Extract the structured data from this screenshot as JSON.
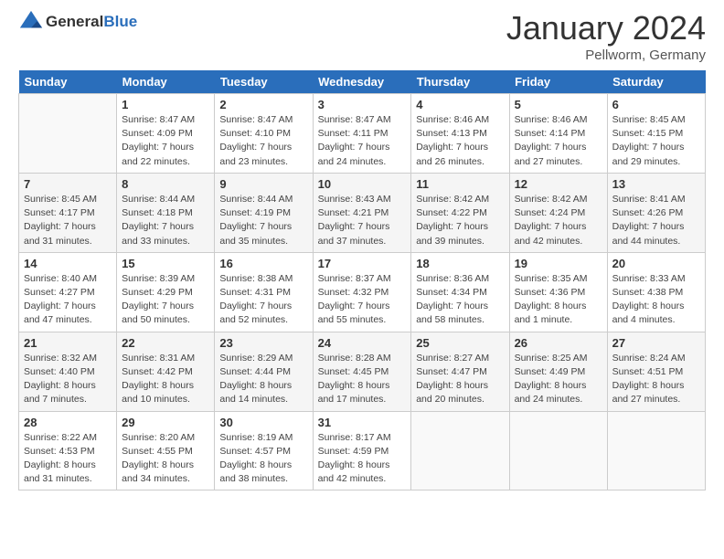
{
  "logo": {
    "text_general": "General",
    "text_blue": "Blue"
  },
  "title": "January 2024",
  "location": "Pellworm, Germany",
  "days_of_week": [
    "Sunday",
    "Monday",
    "Tuesday",
    "Wednesday",
    "Thursday",
    "Friday",
    "Saturday"
  ],
  "weeks": [
    [
      {
        "date": "",
        "sunrise": "",
        "sunset": "",
        "daylight": ""
      },
      {
        "date": "1",
        "sunrise": "Sunrise: 8:47 AM",
        "sunset": "Sunset: 4:09 PM",
        "daylight": "Daylight: 7 hours and 22 minutes."
      },
      {
        "date": "2",
        "sunrise": "Sunrise: 8:47 AM",
        "sunset": "Sunset: 4:10 PM",
        "daylight": "Daylight: 7 hours and 23 minutes."
      },
      {
        "date": "3",
        "sunrise": "Sunrise: 8:47 AM",
        "sunset": "Sunset: 4:11 PM",
        "daylight": "Daylight: 7 hours and 24 minutes."
      },
      {
        "date": "4",
        "sunrise": "Sunrise: 8:46 AM",
        "sunset": "Sunset: 4:13 PM",
        "daylight": "Daylight: 7 hours and 26 minutes."
      },
      {
        "date": "5",
        "sunrise": "Sunrise: 8:46 AM",
        "sunset": "Sunset: 4:14 PM",
        "daylight": "Daylight: 7 hours and 27 minutes."
      },
      {
        "date": "6",
        "sunrise": "Sunrise: 8:45 AM",
        "sunset": "Sunset: 4:15 PM",
        "daylight": "Daylight: 7 hours and 29 minutes."
      }
    ],
    [
      {
        "date": "7",
        "sunrise": "Sunrise: 8:45 AM",
        "sunset": "Sunset: 4:17 PM",
        "daylight": "Daylight: 7 hours and 31 minutes."
      },
      {
        "date": "8",
        "sunrise": "Sunrise: 8:44 AM",
        "sunset": "Sunset: 4:18 PM",
        "daylight": "Daylight: 7 hours and 33 minutes."
      },
      {
        "date": "9",
        "sunrise": "Sunrise: 8:44 AM",
        "sunset": "Sunset: 4:19 PM",
        "daylight": "Daylight: 7 hours and 35 minutes."
      },
      {
        "date": "10",
        "sunrise": "Sunrise: 8:43 AM",
        "sunset": "Sunset: 4:21 PM",
        "daylight": "Daylight: 7 hours and 37 minutes."
      },
      {
        "date": "11",
        "sunrise": "Sunrise: 8:42 AM",
        "sunset": "Sunset: 4:22 PM",
        "daylight": "Daylight: 7 hours and 39 minutes."
      },
      {
        "date": "12",
        "sunrise": "Sunrise: 8:42 AM",
        "sunset": "Sunset: 4:24 PM",
        "daylight": "Daylight: 7 hours and 42 minutes."
      },
      {
        "date": "13",
        "sunrise": "Sunrise: 8:41 AM",
        "sunset": "Sunset: 4:26 PM",
        "daylight": "Daylight: 7 hours and 44 minutes."
      }
    ],
    [
      {
        "date": "14",
        "sunrise": "Sunrise: 8:40 AM",
        "sunset": "Sunset: 4:27 PM",
        "daylight": "Daylight: 7 hours and 47 minutes."
      },
      {
        "date": "15",
        "sunrise": "Sunrise: 8:39 AM",
        "sunset": "Sunset: 4:29 PM",
        "daylight": "Daylight: 7 hours and 50 minutes."
      },
      {
        "date": "16",
        "sunrise": "Sunrise: 8:38 AM",
        "sunset": "Sunset: 4:31 PM",
        "daylight": "Daylight: 7 hours and 52 minutes."
      },
      {
        "date": "17",
        "sunrise": "Sunrise: 8:37 AM",
        "sunset": "Sunset: 4:32 PM",
        "daylight": "Daylight: 7 hours and 55 minutes."
      },
      {
        "date": "18",
        "sunrise": "Sunrise: 8:36 AM",
        "sunset": "Sunset: 4:34 PM",
        "daylight": "Daylight: 7 hours and 58 minutes."
      },
      {
        "date": "19",
        "sunrise": "Sunrise: 8:35 AM",
        "sunset": "Sunset: 4:36 PM",
        "daylight": "Daylight: 8 hours and 1 minute."
      },
      {
        "date": "20",
        "sunrise": "Sunrise: 8:33 AM",
        "sunset": "Sunset: 4:38 PM",
        "daylight": "Daylight: 8 hours and 4 minutes."
      }
    ],
    [
      {
        "date": "21",
        "sunrise": "Sunrise: 8:32 AM",
        "sunset": "Sunset: 4:40 PM",
        "daylight": "Daylight: 8 hours and 7 minutes."
      },
      {
        "date": "22",
        "sunrise": "Sunrise: 8:31 AM",
        "sunset": "Sunset: 4:42 PM",
        "daylight": "Daylight: 8 hours and 10 minutes."
      },
      {
        "date": "23",
        "sunrise": "Sunrise: 8:29 AM",
        "sunset": "Sunset: 4:44 PM",
        "daylight": "Daylight: 8 hours and 14 minutes."
      },
      {
        "date": "24",
        "sunrise": "Sunrise: 8:28 AM",
        "sunset": "Sunset: 4:45 PM",
        "daylight": "Daylight: 8 hours and 17 minutes."
      },
      {
        "date": "25",
        "sunrise": "Sunrise: 8:27 AM",
        "sunset": "Sunset: 4:47 PM",
        "daylight": "Daylight: 8 hours and 20 minutes."
      },
      {
        "date": "26",
        "sunrise": "Sunrise: 8:25 AM",
        "sunset": "Sunset: 4:49 PM",
        "daylight": "Daylight: 8 hours and 24 minutes."
      },
      {
        "date": "27",
        "sunrise": "Sunrise: 8:24 AM",
        "sunset": "Sunset: 4:51 PM",
        "daylight": "Daylight: 8 hours and 27 minutes."
      }
    ],
    [
      {
        "date": "28",
        "sunrise": "Sunrise: 8:22 AM",
        "sunset": "Sunset: 4:53 PM",
        "daylight": "Daylight: 8 hours and 31 minutes."
      },
      {
        "date": "29",
        "sunrise": "Sunrise: 8:20 AM",
        "sunset": "Sunset: 4:55 PM",
        "daylight": "Daylight: 8 hours and 34 minutes."
      },
      {
        "date": "30",
        "sunrise": "Sunrise: 8:19 AM",
        "sunset": "Sunset: 4:57 PM",
        "daylight": "Daylight: 8 hours and 38 minutes."
      },
      {
        "date": "31",
        "sunrise": "Sunrise: 8:17 AM",
        "sunset": "Sunset: 4:59 PM",
        "daylight": "Daylight: 8 hours and 42 minutes."
      },
      {
        "date": "",
        "sunrise": "",
        "sunset": "",
        "daylight": ""
      },
      {
        "date": "",
        "sunrise": "",
        "sunset": "",
        "daylight": ""
      },
      {
        "date": "",
        "sunrise": "",
        "sunset": "",
        "daylight": ""
      }
    ]
  ]
}
